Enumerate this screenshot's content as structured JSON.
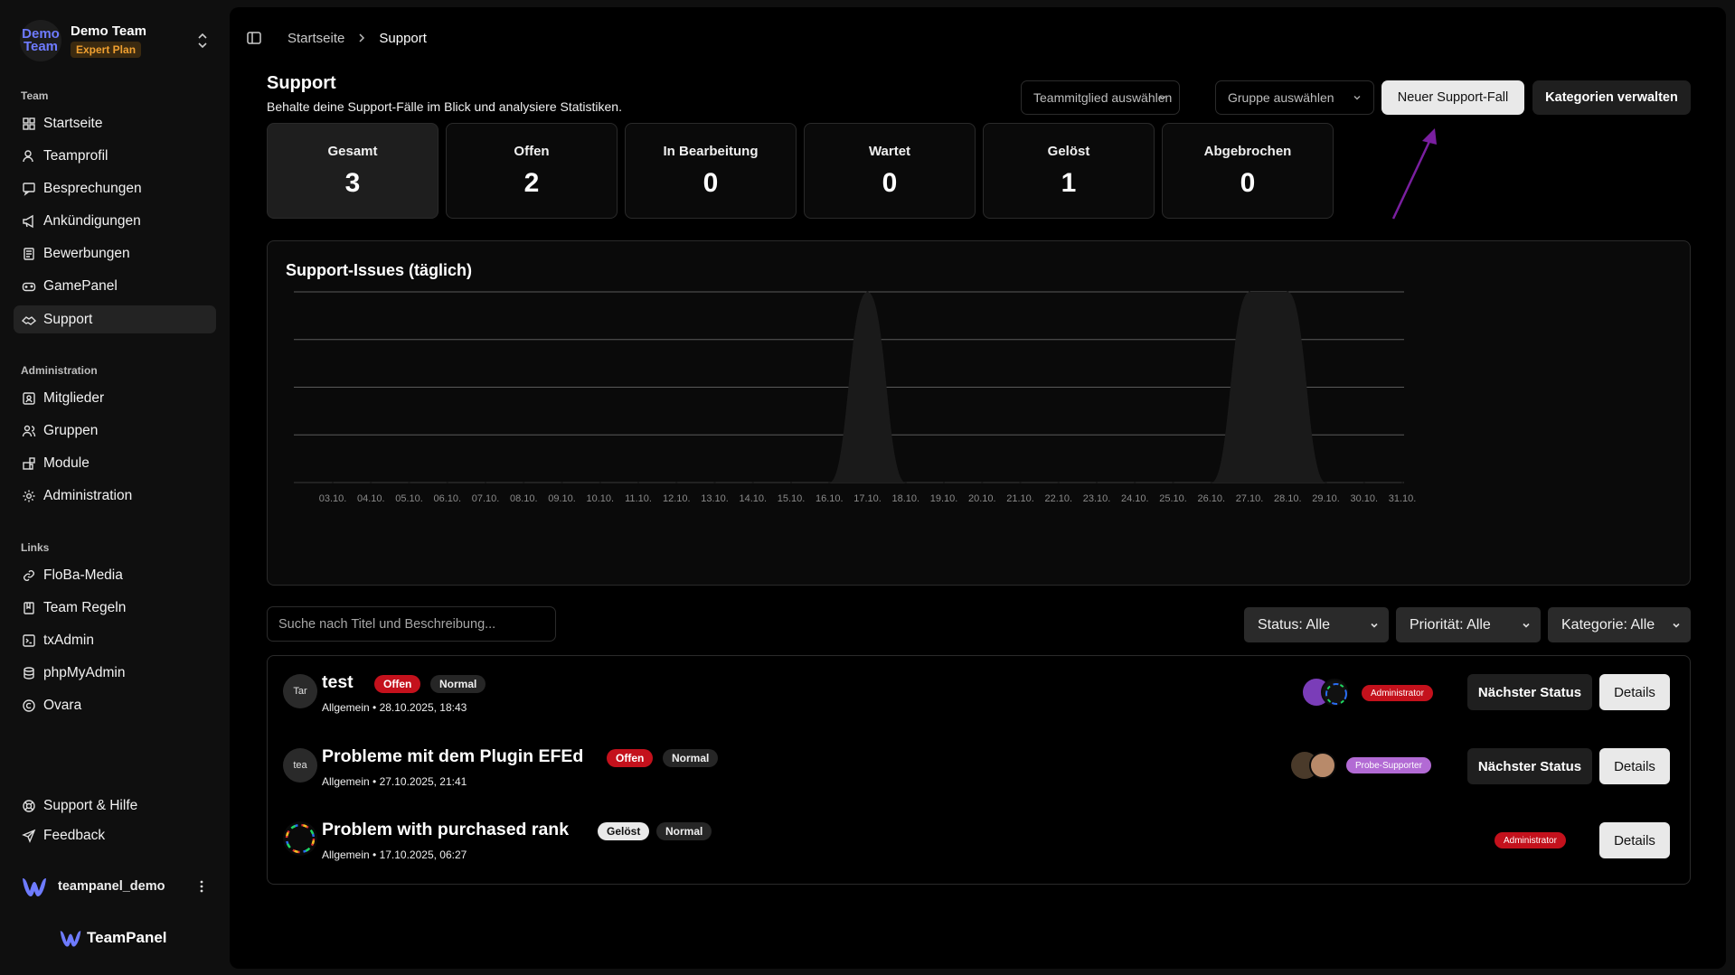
{
  "team": {
    "logo_line1": "Demo",
    "logo_line2": "Team",
    "name": "Demo Team",
    "plan": "Expert Plan"
  },
  "nav": {
    "team_title": "Team",
    "team_items": [
      {
        "label": "Startseite",
        "icon": "home-grid-icon"
      },
      {
        "label": "Teamprofil",
        "icon": "user-icon"
      },
      {
        "label": "Besprechungen",
        "icon": "chat-icon"
      },
      {
        "label": "Ankündigungen",
        "icon": "megaphone-icon"
      },
      {
        "label": "Bewerbungen",
        "icon": "form-icon"
      },
      {
        "label": "GamePanel",
        "icon": "gamepad-icon"
      },
      {
        "label": "Support",
        "icon": "handshake-icon"
      }
    ],
    "admin_title": "Administration",
    "admin_items": [
      {
        "label": "Mitglieder",
        "icon": "id-card-icon"
      },
      {
        "label": "Gruppen",
        "icon": "users-icon"
      },
      {
        "label": "Module",
        "icon": "puzzle-icon"
      },
      {
        "label": "Administration",
        "icon": "gear-icon"
      }
    ],
    "links_title": "Links",
    "link_items": [
      {
        "label": "FloBa-Media",
        "icon": "link-icon"
      },
      {
        "label": "Team Regeln",
        "icon": "book-icon"
      },
      {
        "label": "txAdmin",
        "icon": "terminal-icon"
      },
      {
        "label": "phpMyAdmin",
        "icon": "database-icon"
      },
      {
        "label": "Ovara",
        "icon": "copyright-icon"
      }
    ],
    "footer_items": [
      {
        "label": "Support & Hilfe",
        "icon": "lifebuoy-icon"
      },
      {
        "label": "Feedback",
        "icon": "send-icon"
      }
    ]
  },
  "user": {
    "name": "teampanel_demo"
  },
  "brand": {
    "name": "TeamPanel"
  },
  "breadcrumb": {
    "home": "Startseite",
    "current": "Support"
  },
  "page": {
    "title": "Support",
    "subtitle": "Behalte deine Support-Fälle im Blick und analysiere Statistiken."
  },
  "filters": {
    "member_placeholder": "Teammitglied auswählen",
    "group_placeholder": "Gruppe auswählen",
    "new_case": "Neuer Support-Fall",
    "manage_categories": "Kategorien verwalten"
  },
  "stats": [
    {
      "label": "Gesamt",
      "value": "3"
    },
    {
      "label": "Offen",
      "value": "2"
    },
    {
      "label": "In Bearbeitung",
      "value": "0"
    },
    {
      "label": "Wartet",
      "value": "0"
    },
    {
      "label": "Gelöst",
      "value": "1"
    },
    {
      "label": "Abgebrochen",
      "value": "0"
    }
  ],
  "chart_data": {
    "type": "area",
    "title": "Support-Issues (täglich)",
    "x": [
      "03.10.",
      "04.10.",
      "05.10.",
      "06.10.",
      "07.10.",
      "08.10.",
      "09.10.",
      "10.10.",
      "11.10.",
      "12.10.",
      "13.10.",
      "14.10.",
      "15.10.",
      "16.10.",
      "17.10.",
      "18.10.",
      "19.10.",
      "20.10.",
      "21.10.",
      "22.10.",
      "23.10.",
      "24.10.",
      "25.10.",
      "26.10.",
      "27.10.",
      "28.10.",
      "29.10.",
      "30.10.",
      "31.10."
    ],
    "values": [
      0,
      0,
      0,
      0,
      0,
      0,
      0,
      0,
      0,
      0,
      0,
      0,
      0,
      0,
      1,
      0,
      0,
      0,
      0,
      0,
      0,
      0,
      0,
      0,
      1,
      1,
      0,
      0,
      0
    ],
    "ylim": [
      0,
      1
    ],
    "grid": true,
    "fill_color": "#1a1a1a"
  },
  "list_controls": {
    "search_placeholder": "Suche nach Titel und Beschreibung...",
    "status": "Status: Alle",
    "priority": "Priorität: Alle",
    "category": "Kategorie: Alle"
  },
  "tickets": [
    {
      "avatar": "Tar",
      "title": "test",
      "status": "Offen",
      "priority": "Normal",
      "meta": "Allgemein • 28.10.2025, 18:43",
      "role": "Administrator",
      "next": "Nächster Status",
      "details": "Details"
    },
    {
      "avatar": "tea",
      "title": "Probleme mit dem Plugin EFEd",
      "status": "Offen",
      "priority": "Normal",
      "meta": "Allgemein • 27.10.2025, 21:41",
      "role": "Probe-Supporter",
      "next": "Nächster Status",
      "details": "Details"
    },
    {
      "avatar": "",
      "title": "Problem with purchased rank",
      "status": "Gelöst",
      "priority": "Normal",
      "meta": "Allgemein • 17.10.2025, 06:27",
      "role": "Administrator",
      "details": "Details"
    }
  ]
}
